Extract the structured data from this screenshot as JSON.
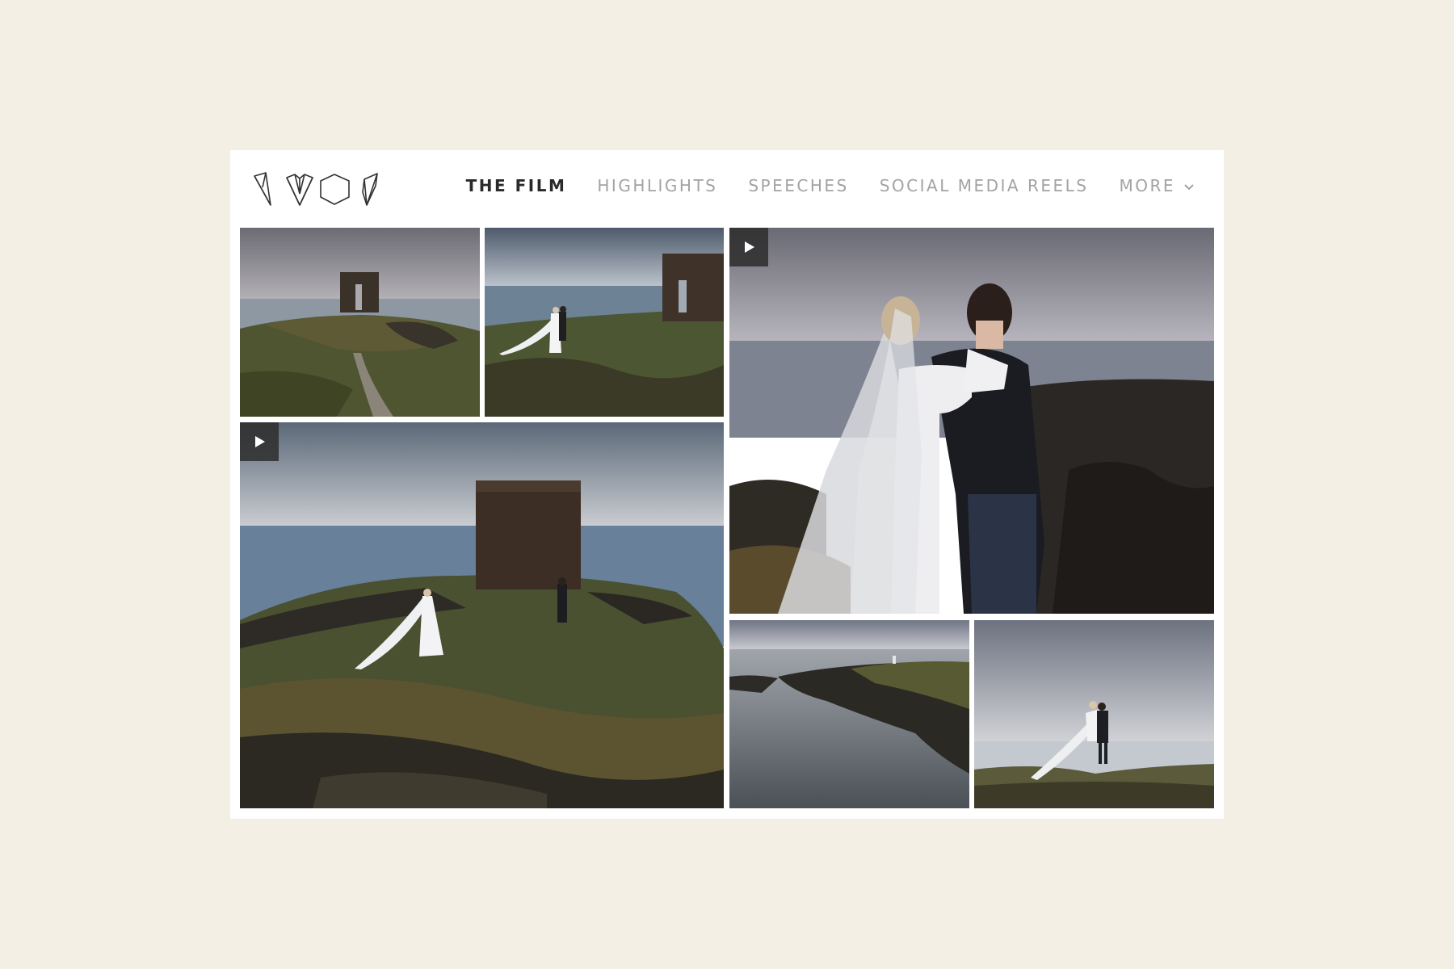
{
  "nav": {
    "items": [
      {
        "label": "THE FILM",
        "active": true
      },
      {
        "label": "HIGHLIGHTS",
        "active": false
      },
      {
        "label": "SPEECHES",
        "active": false
      },
      {
        "label": "SOCIAL MEDIA REELS",
        "active": false
      },
      {
        "label": "MORE",
        "active": false
      }
    ]
  },
  "logo": {
    "icons": [
      "pen-nib-icon",
      "heart-facet-icon",
      "hexagon-icon",
      "crystal-icon"
    ]
  },
  "gallery": {
    "tiles": [
      {
        "name": "tower-path-photo",
        "video": false
      },
      {
        "name": "couple-by-tower-photo",
        "video": false
      },
      {
        "name": "couple-closeup-video",
        "video": true
      },
      {
        "name": "aerial-tower-video",
        "video": true
      },
      {
        "name": "coastline-photo",
        "video": false
      },
      {
        "name": "couple-lift-photo",
        "video": false
      }
    ]
  },
  "colors": {
    "page_background": "#f3efe4",
    "nav_active": "#2a2a2a",
    "nav_inactive": "#a3a3a3",
    "play_badge": "#2d2d2d"
  }
}
